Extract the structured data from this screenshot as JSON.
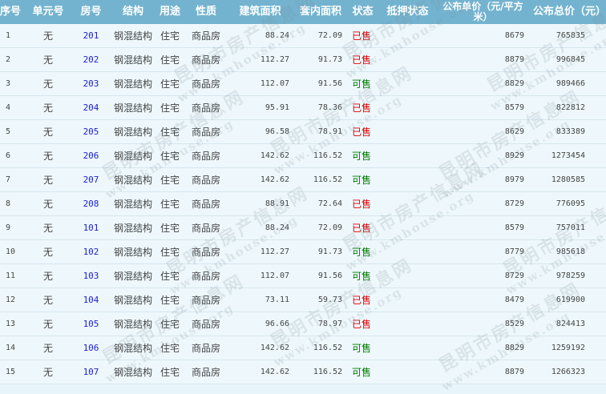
{
  "headers": {
    "idx": "序号",
    "unit": "单元号",
    "room": "房号",
    "structure": "结构",
    "usage": "用途",
    "nature": "性质",
    "build_area": "建筑面积",
    "inner_area": "套内面积",
    "status": "状态",
    "mortgage": "抵押状态",
    "unit_price": "公布单价（元/平方米）",
    "total_price": "公布总价（元）"
  },
  "rows": [
    {
      "idx": "1",
      "unit": "无",
      "room": "201",
      "structure": "钢混结构",
      "usage": "住宅",
      "nature": "商品房",
      "build_area": "88.24",
      "inner_area": "72.09",
      "status": "已售",
      "status_type": "sold",
      "mortgage": "",
      "unit_price": "8679",
      "total_price": "765835"
    },
    {
      "idx": "2",
      "unit": "无",
      "room": "202",
      "structure": "钢混结构",
      "usage": "住宅",
      "nature": "商品房",
      "build_area": "112.27",
      "inner_area": "91.73",
      "status": "已售",
      "status_type": "sold",
      "mortgage": "",
      "unit_price": "8879",
      "total_price": "996845"
    },
    {
      "idx": "3",
      "unit": "无",
      "room": "203",
      "structure": "钢混结构",
      "usage": "住宅",
      "nature": "商品房",
      "build_area": "112.07",
      "inner_area": "91.56",
      "status": "可售",
      "status_type": "avail",
      "mortgage": "",
      "unit_price": "8829",
      "total_price": "989466"
    },
    {
      "idx": "4",
      "unit": "无",
      "room": "204",
      "structure": "钢混结构",
      "usage": "住宅",
      "nature": "商品房",
      "build_area": "95.91",
      "inner_area": "78.36",
      "status": "已售",
      "status_type": "sold",
      "mortgage": "",
      "unit_price": "8579",
      "total_price": "822812"
    },
    {
      "idx": "5",
      "unit": "无",
      "room": "205",
      "structure": "钢混结构",
      "usage": "住宅",
      "nature": "商品房",
      "build_area": "96.58",
      "inner_area": "78.91",
      "status": "已售",
      "status_type": "sold",
      "mortgage": "",
      "unit_price": "8629",
      "total_price": "833389"
    },
    {
      "idx": "6",
      "unit": "无",
      "room": "206",
      "structure": "钢混结构",
      "usage": "住宅",
      "nature": "商品房",
      "build_area": "142.62",
      "inner_area": "116.52",
      "status": "可售",
      "status_type": "avail",
      "mortgage": "",
      "unit_price": "8929",
      "total_price": "1273454"
    },
    {
      "idx": "7",
      "unit": "无",
      "room": "207",
      "structure": "钢混结构",
      "usage": "住宅",
      "nature": "商品房",
      "build_area": "142.62",
      "inner_area": "116.52",
      "status": "可售",
      "status_type": "avail",
      "mortgage": "",
      "unit_price": "8979",
      "total_price": "1280585"
    },
    {
      "idx": "8",
      "unit": "无",
      "room": "208",
      "structure": "钢混结构",
      "usage": "住宅",
      "nature": "商品房",
      "build_area": "88.91",
      "inner_area": "72.64",
      "status": "已售",
      "status_type": "sold",
      "mortgage": "",
      "unit_price": "8729",
      "total_price": "776095"
    },
    {
      "idx": "9",
      "unit": "无",
      "room": "101",
      "structure": "钢混结构",
      "usage": "住宅",
      "nature": "商品房",
      "build_area": "88.24",
      "inner_area": "72.09",
      "status": "已售",
      "status_type": "sold",
      "mortgage": "",
      "unit_price": "8579",
      "total_price": "757011"
    },
    {
      "idx": "10",
      "unit": "无",
      "room": "102",
      "structure": "钢混结构",
      "usage": "住宅",
      "nature": "商品房",
      "build_area": "112.27",
      "inner_area": "91.73",
      "status": "可售",
      "status_type": "avail",
      "mortgage": "",
      "unit_price": "8779",
      "total_price": "985618"
    },
    {
      "idx": "11",
      "unit": "无",
      "room": "103",
      "structure": "钢混结构",
      "usage": "住宅",
      "nature": "商品房",
      "build_area": "112.07",
      "inner_area": "91.56",
      "status": "可售",
      "status_type": "avail",
      "mortgage": "",
      "unit_price": "8729",
      "total_price": "978259"
    },
    {
      "idx": "12",
      "unit": "无",
      "room": "104",
      "structure": "钢混结构",
      "usage": "住宅",
      "nature": "商品房",
      "build_area": "73.11",
      "inner_area": "59.73",
      "status": "已售",
      "status_type": "sold",
      "mortgage": "",
      "unit_price": "8479",
      "total_price": "619900"
    },
    {
      "idx": "13",
      "unit": "无",
      "room": "105",
      "structure": "钢混结构",
      "usage": "住宅",
      "nature": "商品房",
      "build_area": "96.66",
      "inner_area": "78.97",
      "status": "已售",
      "status_type": "sold",
      "mortgage": "",
      "unit_price": "8529",
      "total_price": "824413"
    },
    {
      "idx": "14",
      "unit": "无",
      "room": "106",
      "structure": "钢混结构",
      "usage": "住宅",
      "nature": "商品房",
      "build_area": "142.62",
      "inner_area": "116.52",
      "status": "可售",
      "status_type": "avail",
      "mortgage": "",
      "unit_price": "8829",
      "total_price": "1259192"
    },
    {
      "idx": "15",
      "unit": "无",
      "room": "107",
      "structure": "钢混结构",
      "usage": "住宅",
      "nature": "商品房",
      "build_area": "142.62",
      "inner_area": "116.52",
      "status": "可售",
      "status_type": "avail",
      "mortgage": "",
      "unit_price": "8879",
      "total_price": "1266323"
    }
  ],
  "watermark": {
    "line1": "昆明市房产信息网",
    "line2": "www.kmhouse.org"
  },
  "colors": {
    "header_bg": "#73b3cf",
    "sold": "#dd0000",
    "available": "#007a00",
    "room_link": "#1c1ccf"
  }
}
